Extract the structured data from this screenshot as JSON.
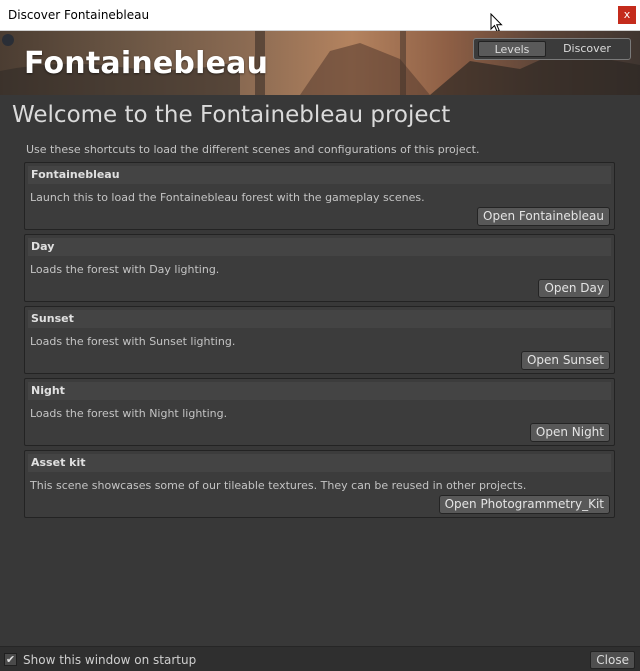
{
  "window": {
    "title": "Discover Fontainebleau",
    "close_glyph": "x"
  },
  "banner": {
    "logo_text": "Fontainebleau",
    "tabs": [
      "Levels",
      "Discover"
    ],
    "active_tab": "Levels"
  },
  "main": {
    "heading": "Welcome to the Fontainebleau project",
    "intro": "Use these shortcuts to load the different scenes and configurations of this project.",
    "cards": [
      {
        "title": "Fontainebleau",
        "description": "Launch this to load the Fontainebleau forest with the gameplay scenes.",
        "button": "Open Fontainebleau"
      },
      {
        "title": "Day",
        "description": "Loads the forest with Day lighting.",
        "button": "Open Day"
      },
      {
        "title": "Sunset",
        "description": "Loads the forest with Sunset  lighting.",
        "button": "Open Sunset"
      },
      {
        "title": "Night",
        "description": "Loads the forest with Night  lighting.",
        "button": "Open Night"
      },
      {
        "title": "Asset kit",
        "description": "This scene showcases some of our tileable textures. They can be reused in other projects.",
        "button": "Open Photogrammetry_Kit"
      }
    ]
  },
  "footer": {
    "checkbox_label": "Show this window on startup",
    "checked": true,
    "check_glyph": "✔",
    "close_label": "Close"
  },
  "colors": {
    "background": "#383838",
    "card": "#3c3c3c",
    "button": "#585858",
    "close_red": "#c42b1c"
  }
}
